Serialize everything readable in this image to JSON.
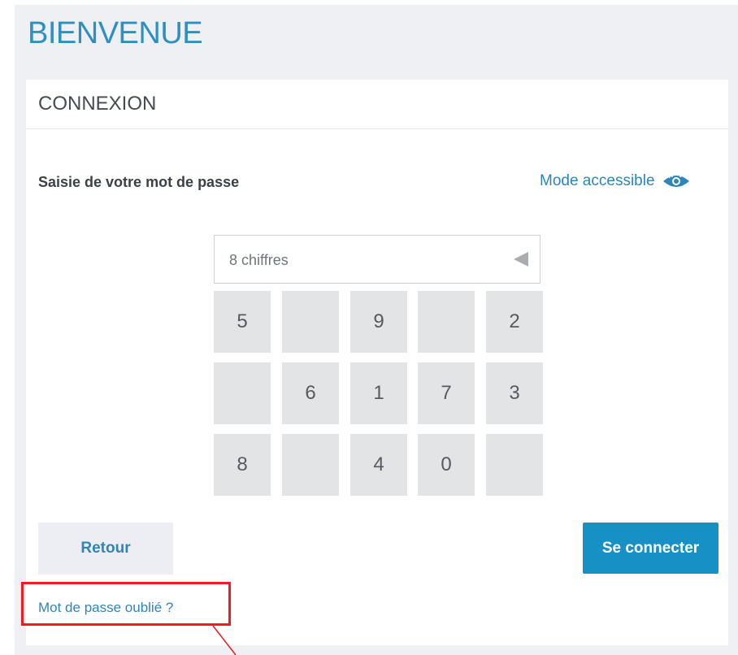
{
  "page": {
    "title": "BIENVENUE"
  },
  "card": {
    "title": "CONNEXION",
    "password_label": "Saisie de votre mot de passe",
    "accessible_link": "Mode accessible",
    "accessible_icon": "eye-icon",
    "pin_placeholder": "8 chiffres",
    "backspace_icon": "backspace-triangle-icon"
  },
  "keypad": {
    "rows": [
      [
        "5",
        "",
        "9",
        "",
        "2"
      ],
      [
        "",
        "6",
        "1",
        "7",
        "3"
      ],
      [
        "8",
        "",
        "4",
        "0",
        ""
      ]
    ]
  },
  "buttons": {
    "back_label": "Retour",
    "connect_label": "Se connecter"
  },
  "links": {
    "forgot_password": "Mot de passe oublié ?"
  },
  "colors": {
    "accent": "#2e8fc1",
    "primary_button": "#1690c5",
    "key_bg": "#e3e4e6",
    "highlight": "#ee1b24"
  }
}
